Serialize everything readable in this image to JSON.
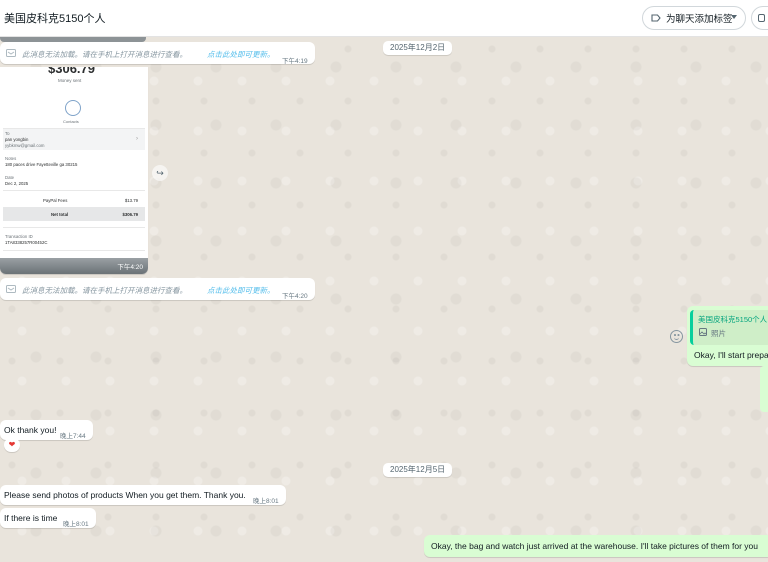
{
  "header": {
    "title": "美国皮科克5150个人",
    "label_button": "为聊天添加标签"
  },
  "dates": {
    "first": "2025年12月2日",
    "second": "2025年12月5日"
  },
  "system_messages": [
    {
      "text": "此消息无法加载。请在手机上打开消息进行查看。",
      "link": "点击此处即可更新。",
      "time": "下午4:19"
    },
    {
      "text": "此消息无法加载。请在手机上打开消息进行查看。",
      "link": "点击此处即可更新。",
      "time": "下午4:20"
    }
  ],
  "receipt": {
    "amount": "$306.79",
    "sub": "Money sent",
    "contact_caption": "Contacts",
    "to_label": "To",
    "to_name": "pan yongbin",
    "to_email": "yybkmw@gmail.com",
    "notes_label": "Notes",
    "notes_value": "180 paces drive Fayetteville ga 30215",
    "date_label": "Date",
    "date_value": "Dec 2, 2025",
    "fee_label": "PayPal Fees",
    "fee_value": "$13.79",
    "net_label": "Net total",
    "net_value": "$306.79",
    "txn_label": "Transaction ID",
    "txn_value": "1TA8338257R00452C",
    "time": "下午4:20"
  },
  "outgoing_reply": {
    "quoted_sender": "美国皮科克5150个人",
    "quoted_type": "照片",
    "text": "Okay, I'll start prepa"
  },
  "messages": {
    "ok_thanks": {
      "text": "Ok thank you!",
      "time": "晚上7:44"
    },
    "reaction": "❤",
    "send_photos": {
      "text": "Please send photos of products When you get them. Thank you.",
      "time": "晚上8:01"
    },
    "if_time": {
      "text": "If there is time",
      "time": "晚上8:01"
    },
    "arrived": {
      "text": "Okay, the bag and watch just arrived at the warehouse. I'll take pictures of them for you"
    }
  },
  "colors": {
    "outgoing_bubble": "#d9fdd3",
    "link": "#53bdeb",
    "quote_accent": "#06cf9c"
  }
}
